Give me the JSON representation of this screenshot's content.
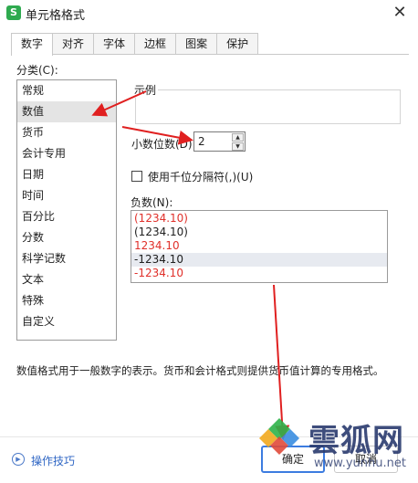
{
  "window": {
    "title": "单元格格式",
    "app_icon_letter": "S",
    "close_symbol": "✕"
  },
  "tabs": [
    {
      "label": "数字"
    },
    {
      "label": "对齐"
    },
    {
      "label": "字体"
    },
    {
      "label": "边框"
    },
    {
      "label": "图案"
    },
    {
      "label": "保护"
    }
  ],
  "category": {
    "label": "分类(C):",
    "items": [
      "常规",
      "数值",
      "货币",
      "会计专用",
      "日期",
      "时间",
      "百分比",
      "分数",
      "科学记数",
      "文本",
      "特殊",
      "自定义"
    ],
    "selected": "数值"
  },
  "sample": {
    "label": "示例"
  },
  "decimal": {
    "label": "小数位数(D):",
    "value": "2"
  },
  "thousands": {
    "label": "使用千位分隔符(,)(U)",
    "checked": false
  },
  "negative": {
    "label": "负数(N):",
    "items": [
      {
        "text": "(1234.10)",
        "color": "red"
      },
      {
        "text": "(1234.10)",
        "color": "black"
      },
      {
        "text": "1234.10",
        "color": "red"
      },
      {
        "text": "-1234.10",
        "color": "black"
      },
      {
        "text": "-1234.10",
        "color": "red"
      }
    ],
    "selected_index": 3
  },
  "description": "数值格式用于一般数字的表示。货币和会计格式则提供货币值计算的专用格式。",
  "footer": {
    "tips": "操作技巧",
    "ok": "确定",
    "cancel": "取消"
  },
  "watermark": {
    "text": "雲狐网",
    "url": "www.yunhu.net"
  },
  "colors": {
    "accent": "#3c7ce0",
    "link": "#2f66c4",
    "negative_red": "#e0302a",
    "annotation_arrow": "#e02020"
  }
}
